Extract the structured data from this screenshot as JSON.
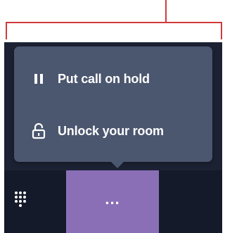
{
  "menu": {
    "items": [
      {
        "label": "Put call on hold",
        "icon": "pause-icon"
      },
      {
        "label": "Unlock your room",
        "icon": "unlock-icon"
      }
    ]
  },
  "toolbar": {
    "more_label": "...",
    "dialpad_icon": "dialpad-icon"
  },
  "colors": {
    "annotation": "#d23a3a",
    "menu_background": "#4b566f",
    "app_background": "#1c2233",
    "toolbar_background": "#141a29",
    "more_button_background": "#8a6fb7"
  }
}
